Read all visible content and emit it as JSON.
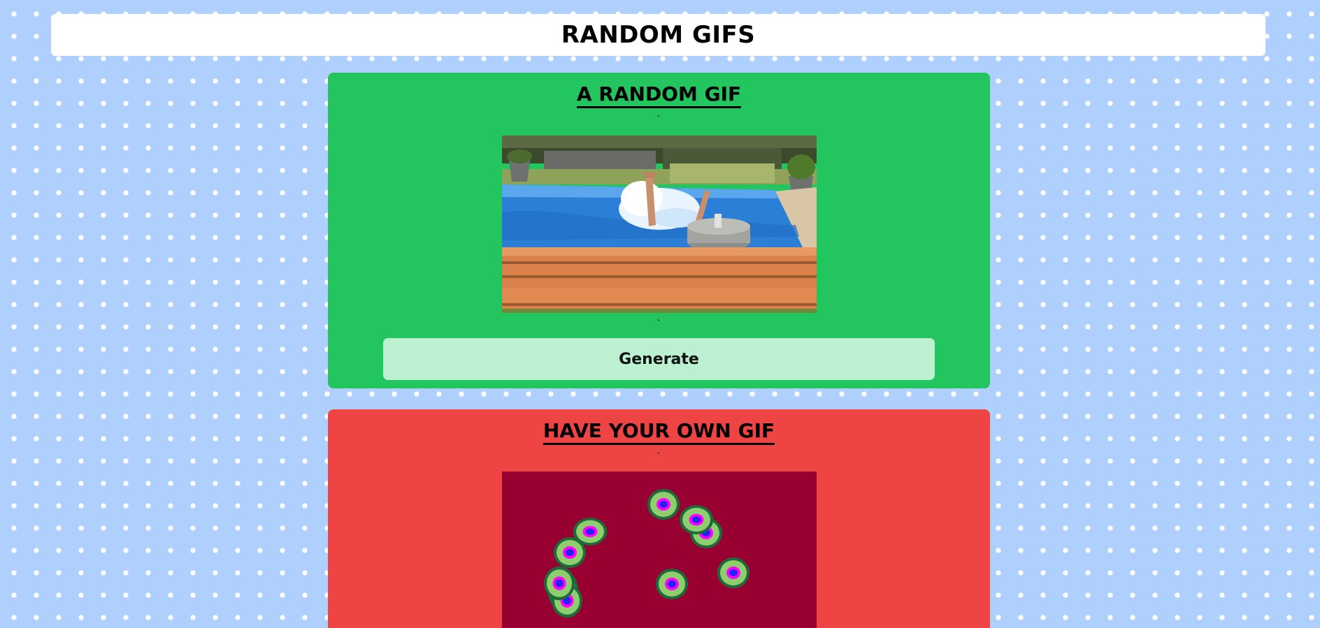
{
  "header": {
    "title": "RANDOM GIFS"
  },
  "random_card": {
    "title": "A RANDOM GIF",
    "tick_top": "`",
    "tick_bottom": "`",
    "image_icon": "pool-dive-gif",
    "button_label": "Generate",
    "bg_color": "#22c55e"
  },
  "own_card": {
    "title": "HAVE YOUR OWN GIF",
    "tick_top": "`",
    "image_icon": "cells-gif",
    "bg_color": "#ef4444"
  },
  "page": {
    "bg_color": "#afd0fd"
  }
}
